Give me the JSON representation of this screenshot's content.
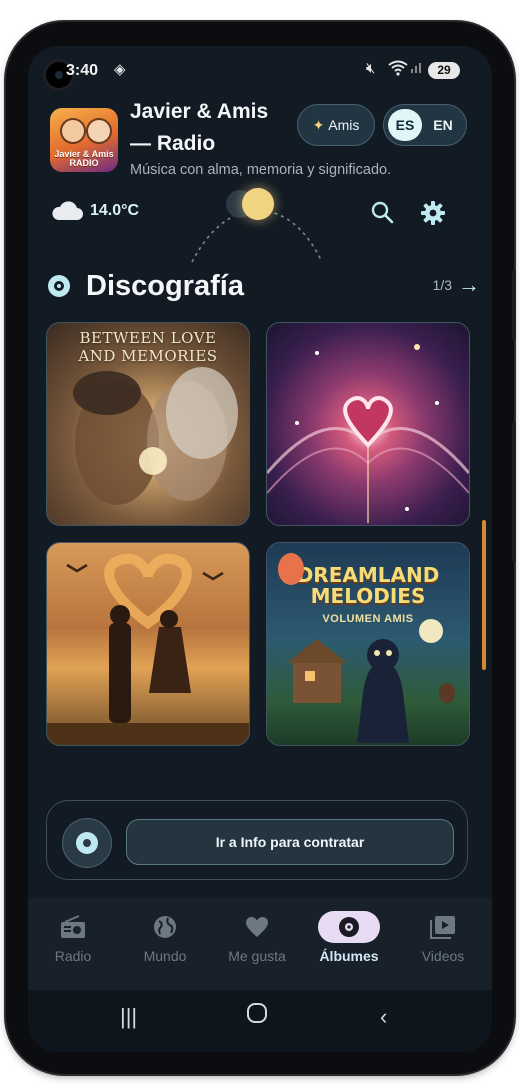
{
  "status_bar": {
    "time": "3:40",
    "battery": "29"
  },
  "header": {
    "app_title_line1": "Javier & Amis",
    "app_title_line2": "— Radio",
    "subtitle": "Música con alma, memoria y significado.",
    "logo_text_line1": "Javier & Amis",
    "logo_text_line2": "RADIO",
    "amis_button": "Amis",
    "lang_active": "ES",
    "lang_inactive": "EN"
  },
  "weather": {
    "temperature": "14.0°C",
    "icon": "cloud-icon"
  },
  "section": {
    "title": "Discografía",
    "pager": "1/3"
  },
  "albums": [
    {
      "caption": "BETWEEN LOVE AND MEMORIES"
    },
    {
      "caption": ""
    },
    {
      "caption": ""
    },
    {
      "caption_line1": "DREAMLAND",
      "caption_line2": "MELODIES",
      "caption_sub": "VOLUMEN AMIS"
    }
  ],
  "cta": {
    "label": "Ir a Info para contratar"
  },
  "bottom_nav": {
    "items": [
      {
        "label": "Radio",
        "icon": "radio-icon"
      },
      {
        "label": "Mundo",
        "icon": "globe-icon"
      },
      {
        "label": "Me gusta",
        "icon": "heart-icon"
      },
      {
        "label": "Álbumes",
        "icon": "album-icon",
        "active": true
      },
      {
        "label": "Videos",
        "icon": "video-icon"
      }
    ]
  },
  "colors": {
    "accent": "#bfe9f1",
    "background": "#121a24",
    "active_pill": "#e8dcf5",
    "scroll": "#d48a2e"
  }
}
